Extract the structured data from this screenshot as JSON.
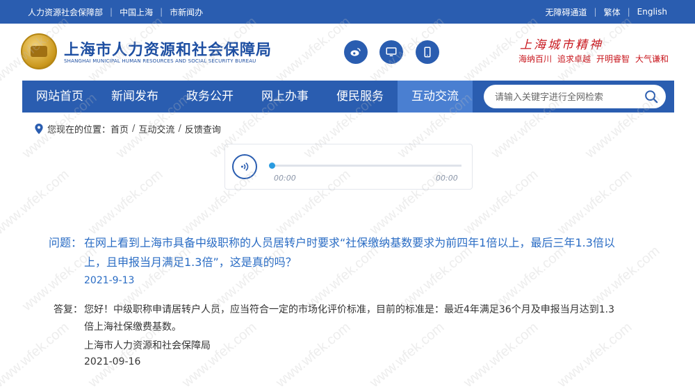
{
  "topbar": {
    "left_links": [
      "人力资源社会保障部",
      "中国上海",
      "市新闻办"
    ],
    "right_links": [
      "无障碍通道",
      "繁体",
      "English"
    ]
  },
  "header": {
    "title": "上海市人力资源和社会保障局",
    "subtitle": "SHANGHAI MUNICIPAL HUMAN RESOURCES AND SOCIAL SECURITY BUREAU",
    "social_icons": [
      "weibo-icon",
      "desktop-icon",
      "mobile-icon"
    ],
    "spirit_title": "上海城市精神",
    "spirit_values": [
      "海纳百川",
      "追求卓越",
      "开明睿智",
      "大气谦和"
    ]
  },
  "nav": {
    "items": [
      {
        "label": "网站首页",
        "active": false
      },
      {
        "label": "新闻发布",
        "active": false
      },
      {
        "label": "政务公开",
        "active": false
      },
      {
        "label": "网上办事",
        "active": false
      },
      {
        "label": "便民服务",
        "active": false
      },
      {
        "label": "互动交流",
        "active": true
      }
    ],
    "search_placeholder": "请输入关键字进行全网检索"
  },
  "breadcrumb": {
    "prefix": "您现在的位置：",
    "items": [
      "首页",
      "互动交流",
      "反馈查询"
    ]
  },
  "player": {
    "current_time": "00:00",
    "total_time": "00:00",
    "progress": 0
  },
  "qa": {
    "question_label": "问题：",
    "question_text": "在网上看到上海市具备中级职称的人员居转户时要求“社保缴纳基数要求为前四年1倍以上，最后三年1.3倍以上，且申报当月满足1.3倍”，这是真的吗？",
    "question_date": "2021-9-13",
    "answer_label": "答复：",
    "answer_text": "您好！中级职称申请居转户人员，应当符合一定的市场化评价标准，目前的标准是：最近4年满足36个月及申报当月达到1.3倍上海社保缴费基数。",
    "answer_signature": "上海市人力资源和社会保障局",
    "answer_date": "2021-09-16"
  },
  "watermark": "www.wfek.com",
  "colors": {
    "primary": "#2a5db0",
    "nav_active": "#4a7fd1",
    "question": "#2a6cc4",
    "spirit": "#c8161d"
  }
}
